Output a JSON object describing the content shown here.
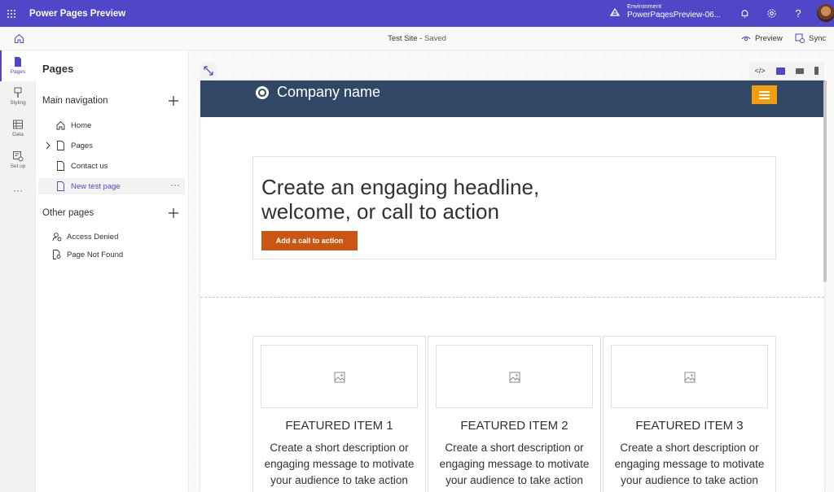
{
  "topbar": {
    "app_title": "Power Pages Preview",
    "env_label": "Environment",
    "env_name": "PowerPaqesPreview-06...",
    "brand_color": "#4f46c8"
  },
  "subbar": {
    "site_name": "Test Site",
    "site_status": "Saved",
    "preview_label": "Preview",
    "sync_label": "Sync"
  },
  "rail": [
    {
      "label": "Pages",
      "icon": "page-icon"
    },
    {
      "label": "Styling",
      "icon": "brush-icon"
    },
    {
      "label": "Data",
      "icon": "table-icon"
    },
    {
      "label": "Set up",
      "icon": "setup-icon"
    }
  ],
  "panel": {
    "title": "Pages",
    "main_nav_title": "Main navigation",
    "main_nav": [
      {
        "label": "Home"
      },
      {
        "label": "Pages"
      },
      {
        "label": "Contact us"
      },
      {
        "label": "New test page"
      }
    ],
    "other_pages_title": "Other pages",
    "other_pages": [
      {
        "label": "Access Denied"
      },
      {
        "label": "Page Not Found"
      }
    ]
  },
  "canvas": {
    "code_label": "</>",
    "company_name": "Company name",
    "hero_title": "Create an engaging headline, welcome, or call to action",
    "cta_label": "Add a call to action",
    "featured": [
      {
        "title": "FEATURED ITEM 1",
        "desc": "Create a short description or engaging message to motivate your audience to take action"
      },
      {
        "title": "FEATURED ITEM 2",
        "desc": "Create a short description or engaging message to motivate your audience to take action"
      },
      {
        "title": "FEATURED ITEM 3",
        "desc": "Create a short description or engaging message to motivate your audience to take action"
      }
    ],
    "header_color": "#304765",
    "accent_color": "#f39c0c",
    "cta_color": "#c95613"
  }
}
